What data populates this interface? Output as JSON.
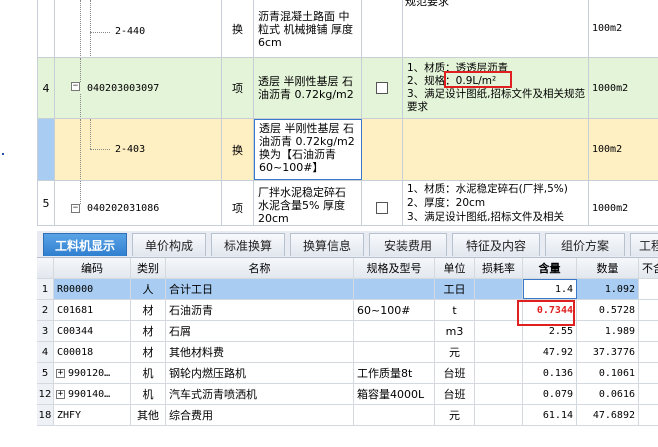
{
  "upper_rows": [
    {
      "rownum": "",
      "code": "2-440",
      "type": "换",
      "name": "沥青混凝土路面 中粒式 机械摊铺 厚度6cm",
      "features": "",
      "unit": "100m2",
      "truncated_top": "规范要求"
    },
    {
      "rownum": "4",
      "code": "040203003097",
      "type": "项",
      "name": "透层 半刚性基层 石油沥青 0.72kg/m2",
      "features": "1、材质：透透层沥青\n2、规格：0.9L/m²\n3、满足设计图纸,招标文件及相关规范要求",
      "unit": "1000m2"
    },
    {
      "rownum": "",
      "code": "2-403",
      "type": "换",
      "name": "透层 半刚性基层 石油沥青 0.72kg/m2\n换为【石油沥青60~100#】",
      "features": "",
      "unit": "100m2"
    },
    {
      "rownum": "5",
      "code": "040202031086",
      "type": "项",
      "name": "厂拌水泥稳定碎石 水泥含量5% 厚度20cm",
      "features": "1、材质：水泥稳定碎石(厂拌,5%)\n2、厚度：20cm\n3、满足设计图纸,招标文件及相关",
      "unit": "1000m2"
    }
  ],
  "tabs": [
    "工料机显示",
    "单价构成",
    "标准换算",
    "换算信息",
    "安装费用",
    "特征及内容",
    "组价方案",
    "工程"
  ],
  "table": {
    "headers": [
      "编码",
      "类别",
      "名称",
      "规格及型号",
      "单位",
      "损耗率",
      "含量",
      "数量",
      "不含"
    ],
    "rows": [
      {
        "num": "1",
        "code": "R00000",
        "expand": false,
        "cat": "人",
        "name": "合计工日",
        "spec": "",
        "unit": "工日",
        "loss": "",
        "content": "1.4",
        "qty": "1.092"
      },
      {
        "num": "2",
        "code": "C01681",
        "expand": false,
        "cat": "材",
        "name": "石油沥青",
        "spec": "60~100#",
        "unit": "t",
        "loss": "",
        "content": "0.7344",
        "qty": "0.5728"
      },
      {
        "num": "3",
        "code": "C00344",
        "expand": false,
        "cat": "材",
        "name": "石屑",
        "spec": "",
        "unit": "m3",
        "loss": "",
        "content": "2.55",
        "qty": "1.989"
      },
      {
        "num": "4",
        "code": "C00018",
        "expand": false,
        "cat": "材",
        "name": "其他材料费",
        "spec": "",
        "unit": "元",
        "loss": "",
        "content": "47.92",
        "qty": "37.3776"
      },
      {
        "num": "5",
        "code": "990120…",
        "expand": true,
        "cat": "机",
        "name": "钢轮内燃压路机",
        "spec": "工作质量8t",
        "unit": "台班",
        "loss": "",
        "content": "0.136",
        "qty": "0.1061"
      },
      {
        "num": "12",
        "code": "990140…",
        "expand": true,
        "cat": "机",
        "name": "汽车式沥青喷洒机",
        "spec": "箱容量4000L",
        "unit": "台班",
        "loss": "",
        "content": "0.079",
        "qty": "0.0616"
      },
      {
        "num": "18",
        "code": "ZHFY",
        "expand": false,
        "cat": "其他",
        "name": "综合费用",
        "spec": "",
        "unit": "元",
        "loss": "",
        "content": "61.14",
        "qty": "47.6892"
      }
    ]
  },
  "colors": {
    "selected_row": "#a9cdf2",
    "green_row": "#e4f4d9",
    "highlight_row": "#fff0c4",
    "active_tab": "#3c8ad8",
    "red_mark": "#e02020"
  }
}
